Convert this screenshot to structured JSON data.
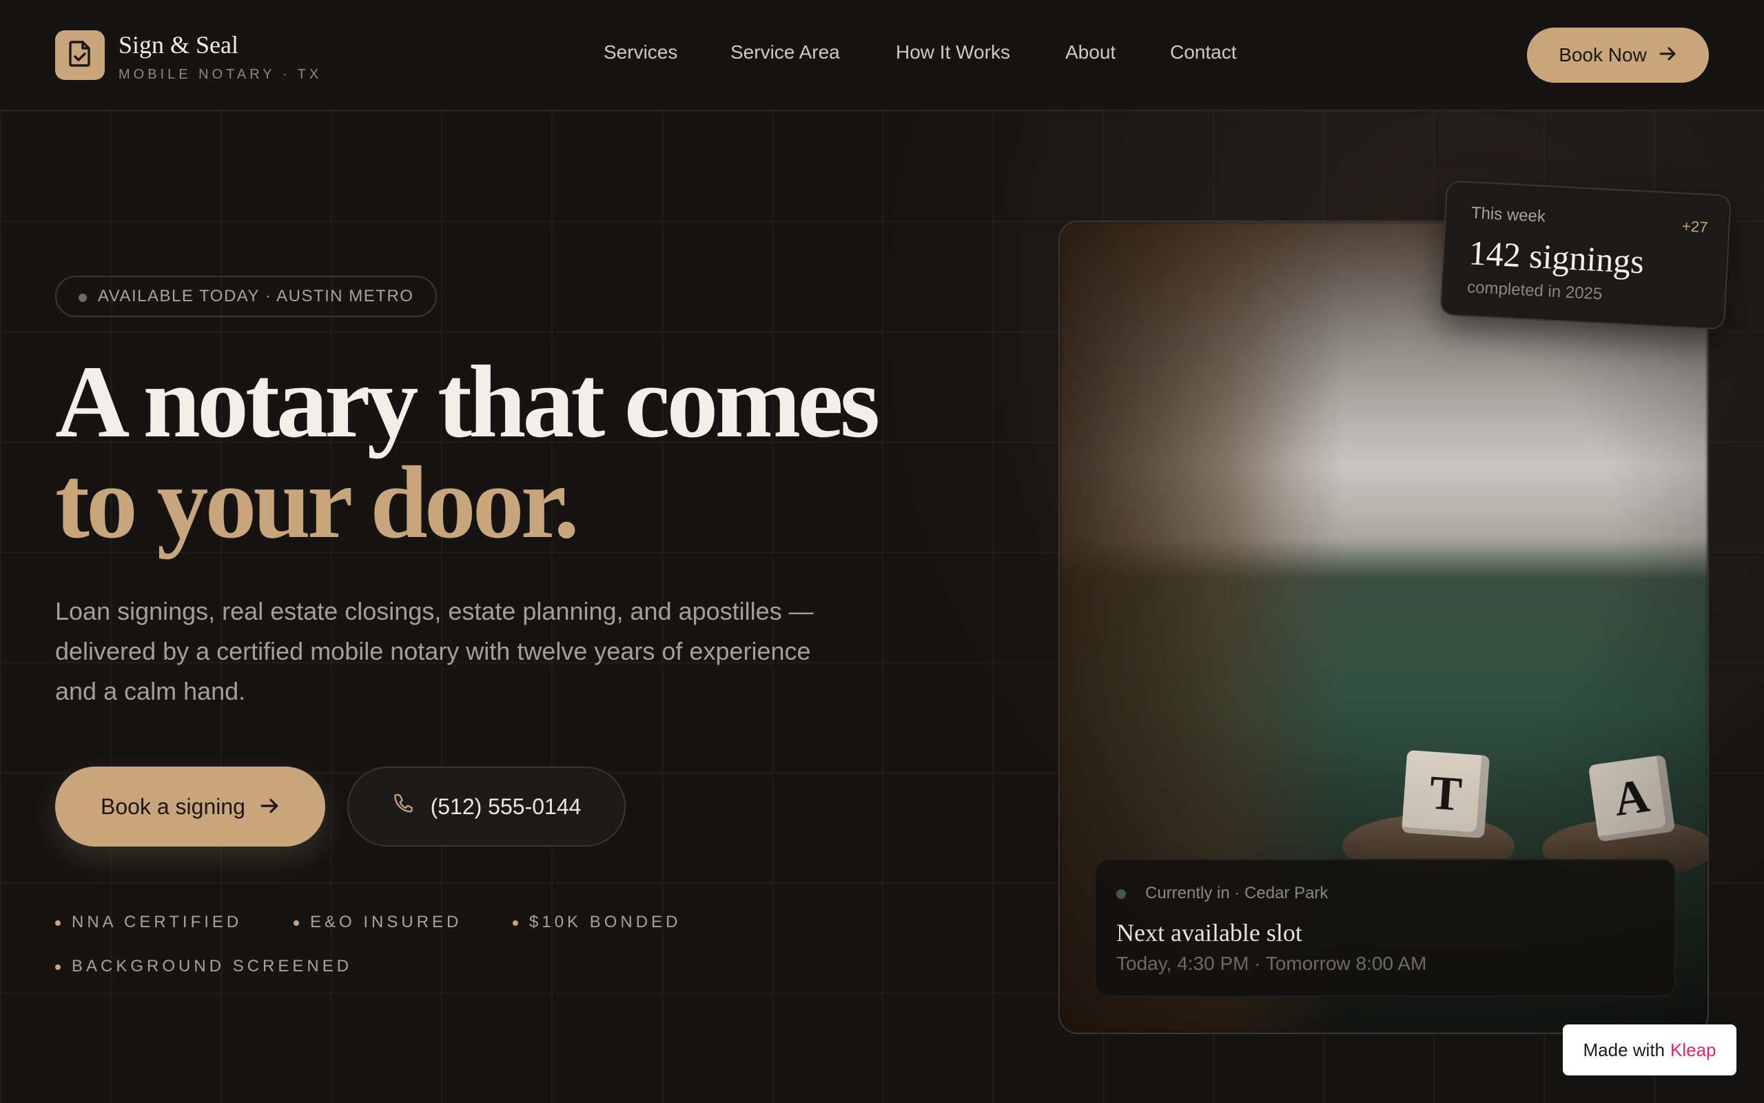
{
  "brand": {
    "name": "Sign & Seal",
    "tagline": "MOBILE NOTARY · TX",
    "logo_icon": "document-check-icon"
  },
  "nav": {
    "items": [
      {
        "label": "Services"
      },
      {
        "label": "Service Area"
      },
      {
        "label": "How It Works"
      },
      {
        "label": "About"
      },
      {
        "label": "Contact"
      }
    ],
    "book_now_label": "Book Now"
  },
  "hero": {
    "badge": "AVAILABLE TODAY · AUSTIN METRO",
    "headline_line1": "A notary that comes",
    "headline_line2": "to your door.",
    "lede": "Loan signings, real estate closings, estate planning, and apostilles — delivered by a certified mobile notary with twelve years of experience and a calm hand.",
    "cta_primary": "Book a signing",
    "cta_phone": "(512) 555-0144",
    "credentials": [
      "NNA CERTIFIED",
      "E&O INSURED",
      "$10K BONDED",
      "BACKGROUND SCREENED"
    ]
  },
  "photo_card": {
    "tiles": [
      "T",
      "A"
    ],
    "status": {
      "location": "Currently in · Cedar Park",
      "title": "Next available slot",
      "times": "Today, 4:30 PM · Tomorrow 8:00 AM"
    }
  },
  "week_card": {
    "label": "This week",
    "delta": "+27",
    "count": "142 signings",
    "sub": "completed in 2025"
  },
  "footer_badge": {
    "prefix": "Made with",
    "brand": "Kleap"
  },
  "colors": {
    "background": "#151413",
    "accent": "#c9a57c",
    "text": "#ece8e1",
    "muted": "#a59f97",
    "status_dot": "#3e5a44",
    "kleap": "#e0246a"
  }
}
